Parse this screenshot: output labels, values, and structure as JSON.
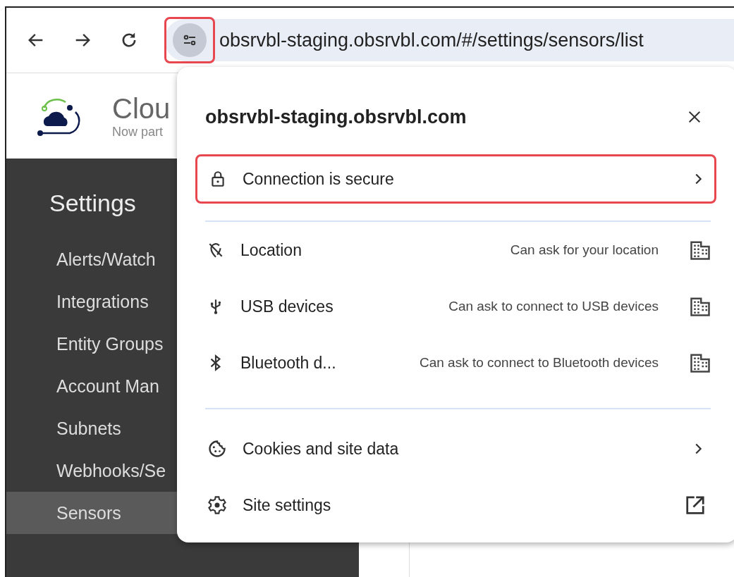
{
  "toolbar": {
    "url": "obsrvbl-staging.obsrvbl.com/#/settings/sensors/list",
    "site_info_highlighted": true
  },
  "app_header": {
    "title": "Clou",
    "subtitle": "Now part"
  },
  "sidebar": {
    "title": "Settings",
    "items": [
      {
        "label": "Alerts/Watch",
        "selected": false
      },
      {
        "label": "Integrations",
        "selected": false
      },
      {
        "label": "Entity Groups",
        "selected": false
      },
      {
        "label": "Account Man",
        "selected": false
      },
      {
        "label": "Subnets",
        "selected": false
      },
      {
        "label": "Webhooks/Se",
        "selected": false
      },
      {
        "label": "Sensors",
        "selected": true
      }
    ]
  },
  "site_popup": {
    "title": "obsrvbl-staging.obsrvbl.com",
    "connection": {
      "label": "Connection is secure",
      "highlighted": true
    },
    "permissions": [
      {
        "kind": "location",
        "label": "Location",
        "status": "Can ask for your location"
      },
      {
        "kind": "usb",
        "label": "USB devices",
        "status": "Can ask to connect to USB devices"
      },
      {
        "kind": "bluetooth",
        "label": "Bluetooth d...",
        "status": "Can ask to connect to Bluetooth devices"
      }
    ],
    "links": [
      {
        "kind": "cookies",
        "label": "Cookies and site data"
      },
      {
        "kind": "settings",
        "label": "Site settings"
      }
    ]
  }
}
